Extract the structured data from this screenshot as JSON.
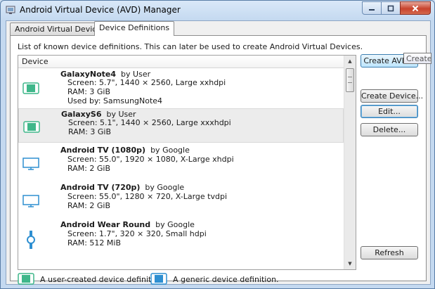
{
  "window": {
    "title": "Android Virtual Device (AVD) Manager"
  },
  "tabs": [
    {
      "label": "Android Virtual Devices",
      "active": false
    },
    {
      "label": "Device Definitions",
      "active": true
    }
  ],
  "description": "List of known device definitions. This can later be used to create Android Virtual Devices.",
  "list": {
    "column_header": "Device",
    "rows": [
      {
        "name": "GalaxyNote4",
        "by": "by User",
        "icon": "phone-user-icon",
        "lines": [
          "Screen:   5.7\", 1440 × 2560, Large xxhdpi",
          "RAM:       3 GiB",
          "Used by: SamsungNote4"
        ]
      },
      {
        "name": "GalaxyS6",
        "by": "by User",
        "icon": "phone-user-icon",
        "selected": true,
        "lines": [
          "Screen:   5.1\", 1440 × 2560, Large xxxhdpi",
          "RAM:       3 GiB"
        ]
      },
      {
        "name": "Android TV (1080p)",
        "by": "by Google",
        "icon": "tv-icon",
        "lines": [
          "Screen:   55.0\", 1920 × 1080, X-Large xhdpi",
          "RAM:       2 GiB"
        ]
      },
      {
        "name": "Android TV (720p)",
        "by": "by Google",
        "icon": "tv-icon",
        "lines": [
          "Screen:   55.0\", 1280 × 720, X-Large tvdpi",
          "RAM:       2 GiB"
        ]
      },
      {
        "name": "Android Wear Round",
        "by": "by Google",
        "icon": "watch-icon",
        "lines": [
          "Screen:   1.7\", 320 × 320, Small hdpi",
          "RAM:       512 MiB"
        ]
      }
    ]
  },
  "buttons": {
    "create_avd": "Create AVD...",
    "create_device": "Create Device...",
    "edit": "Edit...",
    "delete": "Delete...",
    "refresh": "Refresh"
  },
  "tooltip": "Creates",
  "legend": {
    "user": "A user-created device definition.",
    "generic": "A generic device definition."
  },
  "colors": {
    "user_icon": "#3fb78a",
    "generic_icon": "#2e8fd1",
    "selected_row": "#ececec"
  }
}
